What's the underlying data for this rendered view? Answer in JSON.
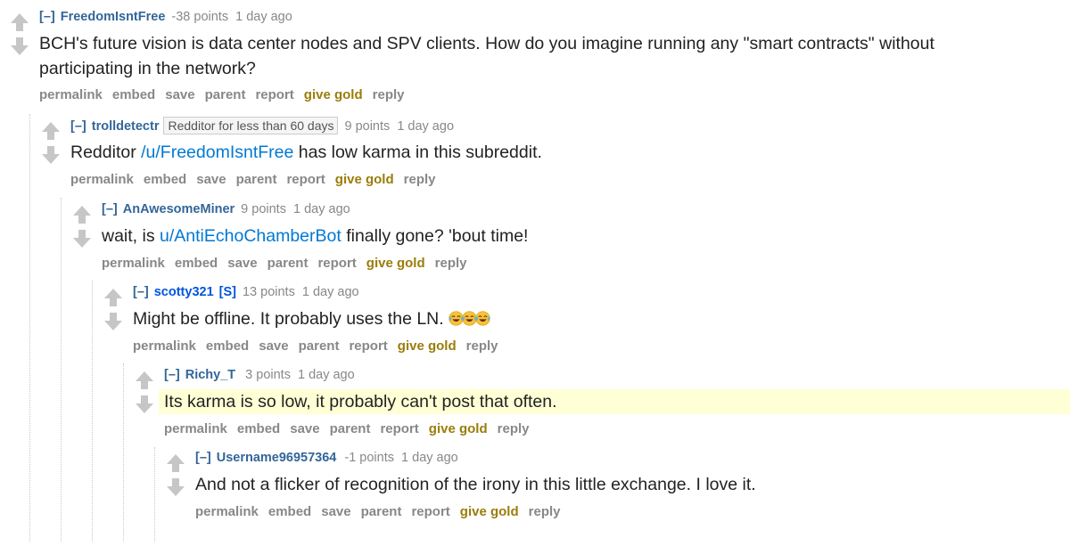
{
  "comments": [
    {
      "collapse": "[–]",
      "author": "FreedomIsntFree",
      "flair": "",
      "op_tag": "",
      "score": "-38 points",
      "time": "1 day ago",
      "body_pre": "BCH's future vision is data center nodes and SPV clients. How do you imagine running any \"smart contracts\" without",
      "body_line2": "participating in the network?"
    },
    {
      "collapse": "[–]",
      "author": "trolldetectr",
      "flair": "Redditor for less than 60 days",
      "score": "9 points",
      "time": "1 day ago",
      "body_pre": "Redditor ",
      "body_link": "/u/FreedomIsntFree",
      "body_post": " has low karma in this subreddit."
    },
    {
      "collapse": "[–]",
      "author": "AnAwesomeMiner",
      "score": "9 points",
      "time": "1 day ago",
      "body_pre": "wait, is ",
      "body_link": "u/AntiEchoChamberBot",
      "body_post": " finally gone? 'bout time!"
    },
    {
      "collapse": "[–]",
      "author": "scotty321",
      "op_tag": "[S]",
      "score": "13 points",
      "time": "1 day ago",
      "body_pre": "Might be offline. It probably uses the LN. ",
      "emoji": [
        "face-with-tears-of-joy-icon",
        "face-with-tears-of-joy-icon",
        "face-with-tears-of-joy-icon"
      ]
    },
    {
      "collapse": "[–]",
      "author": "Richy_T",
      "score": "3 points",
      "time": "1 day ago",
      "body_pre": "Its karma is so low, it probably can't post that often."
    },
    {
      "collapse": "[–]",
      "author": "Username96957364",
      "score": "-1 points",
      "time": "1 day ago",
      "body_pre": "And not a flicker of recognition of the irony in this little exchange. I love it."
    }
  ],
  "buttons": {
    "permalink": "permalink",
    "embed": "embed",
    "save": "save",
    "parent": "parent",
    "report": "report",
    "give_gold": "give gold",
    "reply": "reply"
  },
  "icons": {
    "upvote": "upvote-arrow-icon",
    "downvote": "downvote-arrow-icon"
  },
  "colors": {
    "author": "#336699",
    "link": "#0079d3",
    "gold": "#9a7d0a",
    "highlight": "#ffffd6",
    "meta": "#888888"
  }
}
